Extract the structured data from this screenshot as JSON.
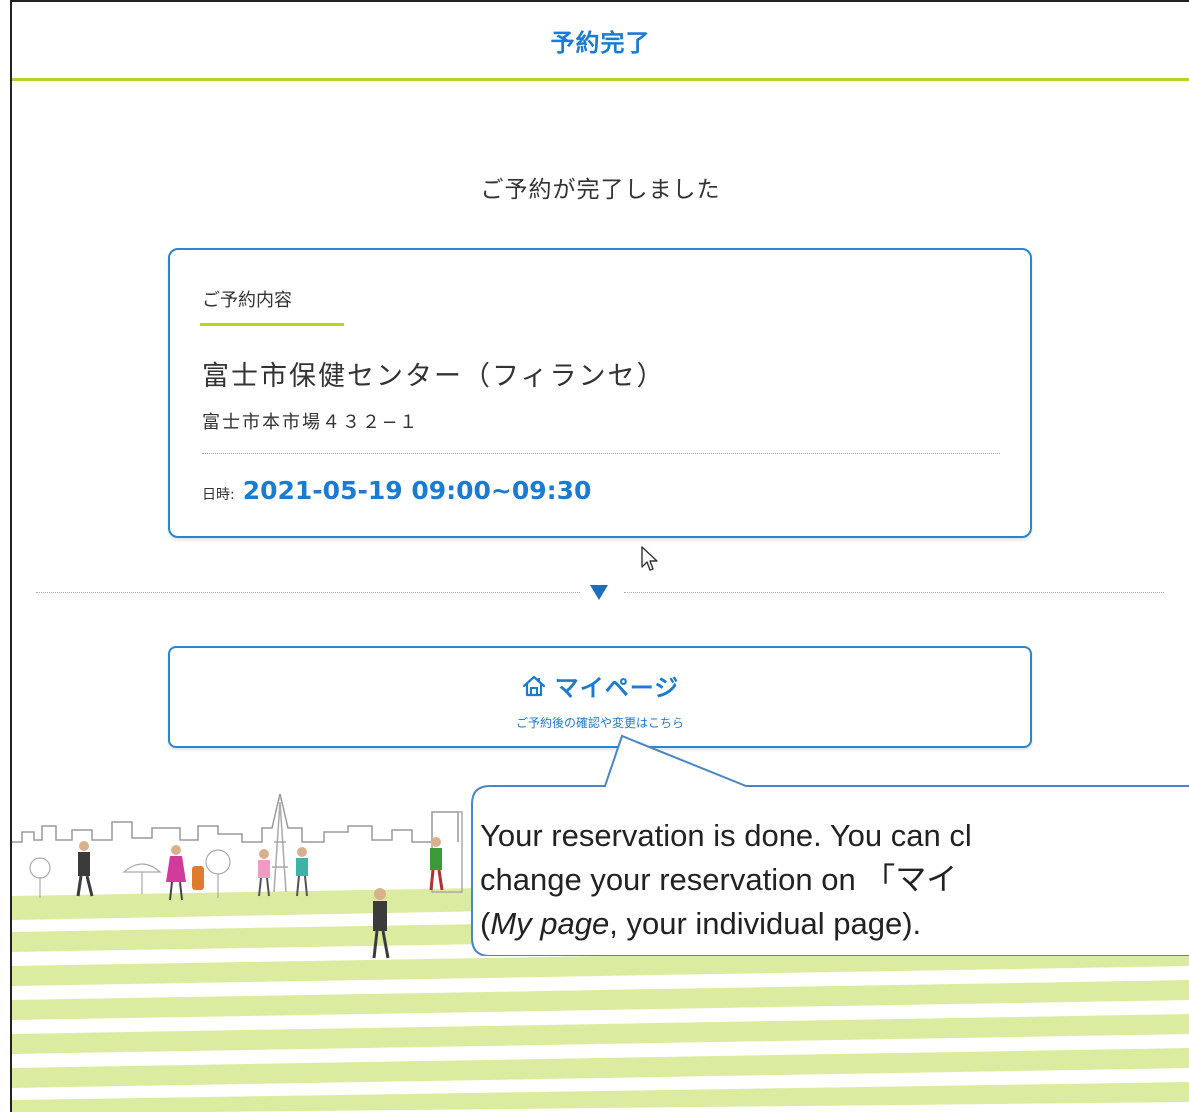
{
  "header": {
    "title": "予約完了"
  },
  "main": {
    "done_message": "ご予約が完了しました",
    "reservation": {
      "label": "ご予約内容",
      "facility_name": "富士市保健センター（フィランセ）",
      "address": "富士市本市場４３２−１",
      "datetime_label": "日時:",
      "datetime_value": "2021-05-19 09:00~09:30"
    },
    "mypage": {
      "icon": "home-icon",
      "title": "マイページ",
      "subtitle": "ご予約後の確認や変更はこちら"
    }
  },
  "annotation": {
    "line1": "Your reservation is done. You can cl",
    "line2": "change your reservation on 「マイ",
    "line3_open": "(",
    "line3_italic": "My page",
    "line3_rest": ", your individual page)."
  },
  "colors": {
    "accent_blue": "#1b7bd1",
    "border_blue": "#2b84d0",
    "accent_green": "#b5d626",
    "callout_border": "#4a86c5"
  }
}
